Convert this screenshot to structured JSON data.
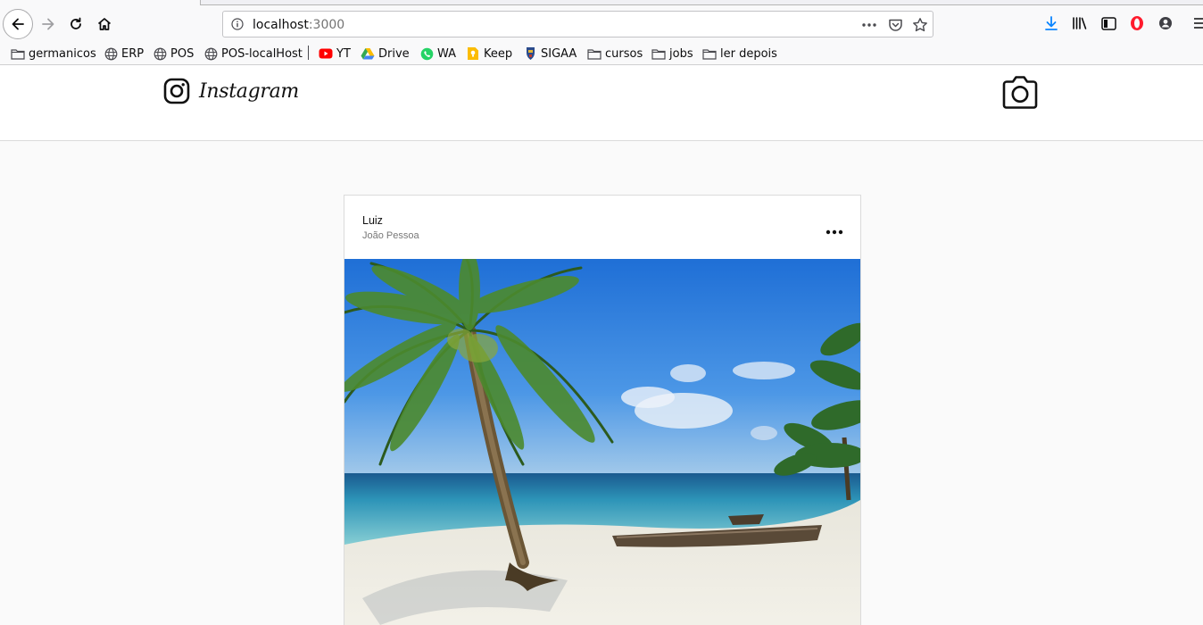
{
  "browser": {
    "url_host": "localhost",
    "url_port": ":3000"
  },
  "bookmarks": [
    {
      "label": "germanicos",
      "icon": "folder-icon"
    },
    {
      "label": "ERP",
      "icon": "globe-icon"
    },
    {
      "label": "POS",
      "icon": "globe-icon"
    },
    {
      "label": "POS-localHost",
      "icon": "globe-icon"
    },
    {
      "label": "YT",
      "icon": "youtube-icon"
    },
    {
      "label": "Drive",
      "icon": "drive-icon"
    },
    {
      "label": "WA",
      "icon": "whatsapp-icon"
    },
    {
      "label": "Keep",
      "icon": "keep-icon"
    },
    {
      "label": "SIGAA",
      "icon": "sigaa-icon"
    },
    {
      "label": "cursos",
      "icon": "folder-icon"
    },
    {
      "label": "jobs",
      "icon": "folder-icon"
    },
    {
      "label": "ler depois",
      "icon": "folder-icon"
    }
  ],
  "app": {
    "logo_text": "Instagram",
    "camera_icon": "camera-icon"
  },
  "post": {
    "author": "Luiz",
    "place": "João Pessoa",
    "image_subject": "tropical beach with palm tree"
  },
  "colors": {
    "accent_blue": "#0a84ff",
    "youtube_red": "#ff0000",
    "whatsapp_green": "#25d366",
    "keep_yellow": "#fbbc04"
  }
}
